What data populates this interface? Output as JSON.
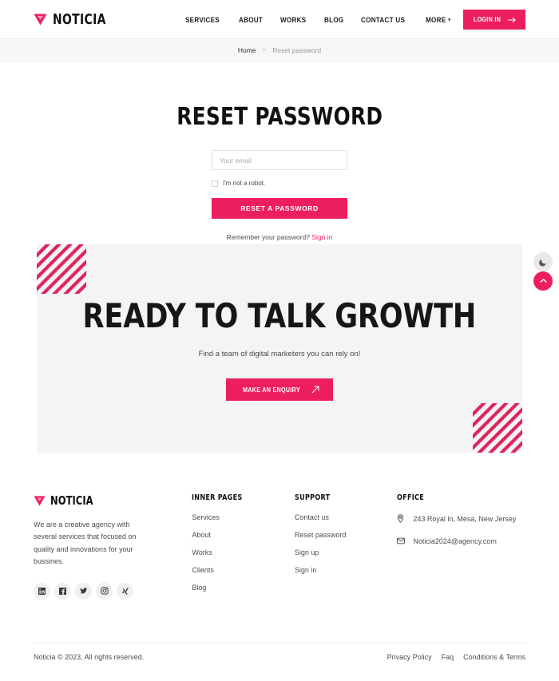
{
  "brand": {
    "name": "NOTICIA",
    "accent": "#ed1e5e",
    "logo_icon": "triangle-down-icon"
  },
  "header": {
    "nav": [
      {
        "label": "SERVICES",
        "name": "nav-item-services"
      },
      {
        "label": "ABOUT",
        "name": "nav-item-about"
      },
      {
        "label": "WORKS",
        "name": "nav-item-works"
      },
      {
        "label": "BLOG",
        "name": "nav-item-blog"
      },
      {
        "label": "CONTACT US",
        "name": "nav-item-contact-us"
      },
      {
        "label": "MORE",
        "name": "nav-item-more",
        "has_caret": true
      }
    ],
    "login_label": "LOGIN IN"
  },
  "breadcrumb": {
    "home": "Home",
    "separator": ">",
    "current": "Reset password"
  },
  "form": {
    "title": "RESET PASSWORD",
    "email_placeholder": "Your email",
    "email_value": "",
    "robot_label": "I'm not a robot.",
    "submit_label": "RESET A PASSWORD",
    "remember_text": "Remember your password?",
    "signin_label": "Sign in"
  },
  "cta": {
    "title": "READY TO TALK GROWTH",
    "subtitle": "Find a team of digital marketers you can rely on!",
    "button_label": "MAKE AN ENQUIRY"
  },
  "floating": {
    "theme_icon": "moon-icon",
    "top_icon": "chevron-up-icon"
  },
  "footer": {
    "brand_name": "NOTICIA",
    "description": "We are a creative agency with several services that focused on quality and innovations for your bussines.",
    "socials": [
      {
        "name": "linkedin-icon",
        "label": "in"
      },
      {
        "name": "facebook-icon",
        "label": "f"
      },
      {
        "name": "twitter-icon",
        "label": "t"
      },
      {
        "name": "instagram-icon",
        "label": "ig"
      },
      {
        "name": "xing-icon",
        "label": "x"
      }
    ],
    "inner_pages": {
      "heading": "INNER PAGES",
      "links": [
        "Services",
        "About",
        "Works",
        "Clients",
        "Blog"
      ]
    },
    "support": {
      "heading": "SUPPORT",
      "links": [
        "Contact us",
        "Reset password",
        "Sign up",
        "Sign in"
      ]
    },
    "office": {
      "heading": "OFFICE",
      "address": "243 Royal ln, Mesa, New Jersey",
      "email": "Noticia2024@agency.com",
      "address_icon": "location-pin-icon",
      "email_icon": "envelope-icon"
    },
    "copyright": "Noticia © 2023, All rights reserved.",
    "bottom_links": [
      "Privacy Policy",
      "Faq",
      "Conditions & Terms"
    ]
  }
}
